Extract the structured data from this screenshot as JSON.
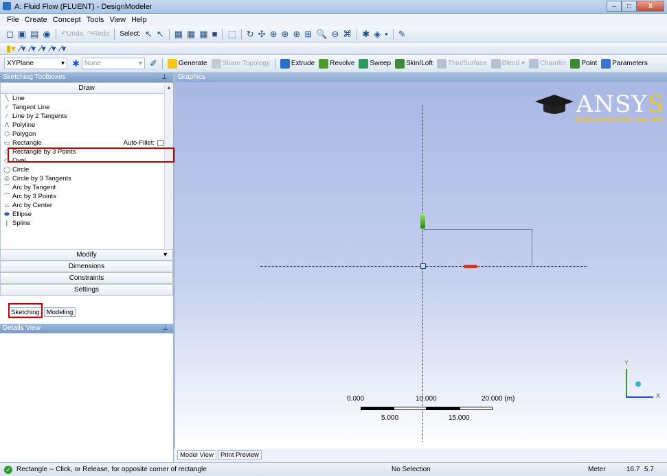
{
  "window": {
    "title": "A: Fluid Flow (FLUENT) - DesignModeler",
    "minimize_label": "–",
    "maximize_label": "□",
    "close_label": "X"
  },
  "menu": [
    "File",
    "Create",
    "Concept",
    "Tools",
    "View",
    "Help"
  ],
  "toolbar1": {
    "undo_label": "Undo",
    "redo_label": "Redo",
    "select_label": "Select:"
  },
  "toolbar3": {
    "plane_value": "XYPlane",
    "sketch_value": "None",
    "buttons": [
      {
        "label": "Generate",
        "enabled": true
      },
      {
        "label": "Share Topology",
        "enabled": false
      },
      {
        "label": "Extrude",
        "enabled": true
      },
      {
        "label": "Revolve",
        "enabled": true
      },
      {
        "label": "Sweep",
        "enabled": true
      },
      {
        "label": "Skin/Loft",
        "enabled": true
      },
      {
        "label": "Thin/Surface",
        "enabled": false
      },
      {
        "label": "Blend",
        "enabled": false
      },
      {
        "label": "Chamfer",
        "enabled": false
      },
      {
        "label": "Point",
        "enabled": true
      },
      {
        "label": "Parameters",
        "enabled": true
      }
    ]
  },
  "sketching_toolboxes": {
    "header": "Sketching Toolboxes",
    "draw_label": "Draw",
    "items": [
      "Line",
      "Tangent Line",
      "Line by 2 Tangents",
      "Polyline",
      "Polygon",
      "Rectangle",
      "Rectangle by 3 Points",
      "Oval",
      "Circle",
      "Circle by 3 Tangents",
      "Arc by Tangent",
      "Arc by 3 Points",
      "Arc by Center",
      "Ellipse",
      "Spline"
    ],
    "auto_fillet_label": "Auto-Fillet:",
    "modify_label": "Modify",
    "dimensions_label": "Dimensions",
    "constraints_label": "Constraints",
    "settings_label": "Settings"
  },
  "tabs": {
    "sketching": "Sketching",
    "modeling": "Modeling"
  },
  "details_view": {
    "header": "Details View"
  },
  "graphics": {
    "header": "Graphics",
    "logo_text_main": "ANSY",
    "logo_text_s": "S",
    "logo_sub": "Noncommercial use only",
    "scale_labels_top": [
      "0.000",
      "10.000",
      "20.000 (m)"
    ],
    "scale_labels_bottom": [
      "5.000",
      "15.000"
    ],
    "triad_x": "X",
    "triad_y": "Y"
  },
  "bottom_tabs": {
    "model_view": "Model View",
    "print_preview": "Print Preview"
  },
  "status": {
    "message": "Rectangle -- Click, or Release, for opposite corner of rectangle",
    "selection": "No Selection",
    "units": "Meter",
    "coord1": "16.7",
    "coord2": "5.7"
  }
}
